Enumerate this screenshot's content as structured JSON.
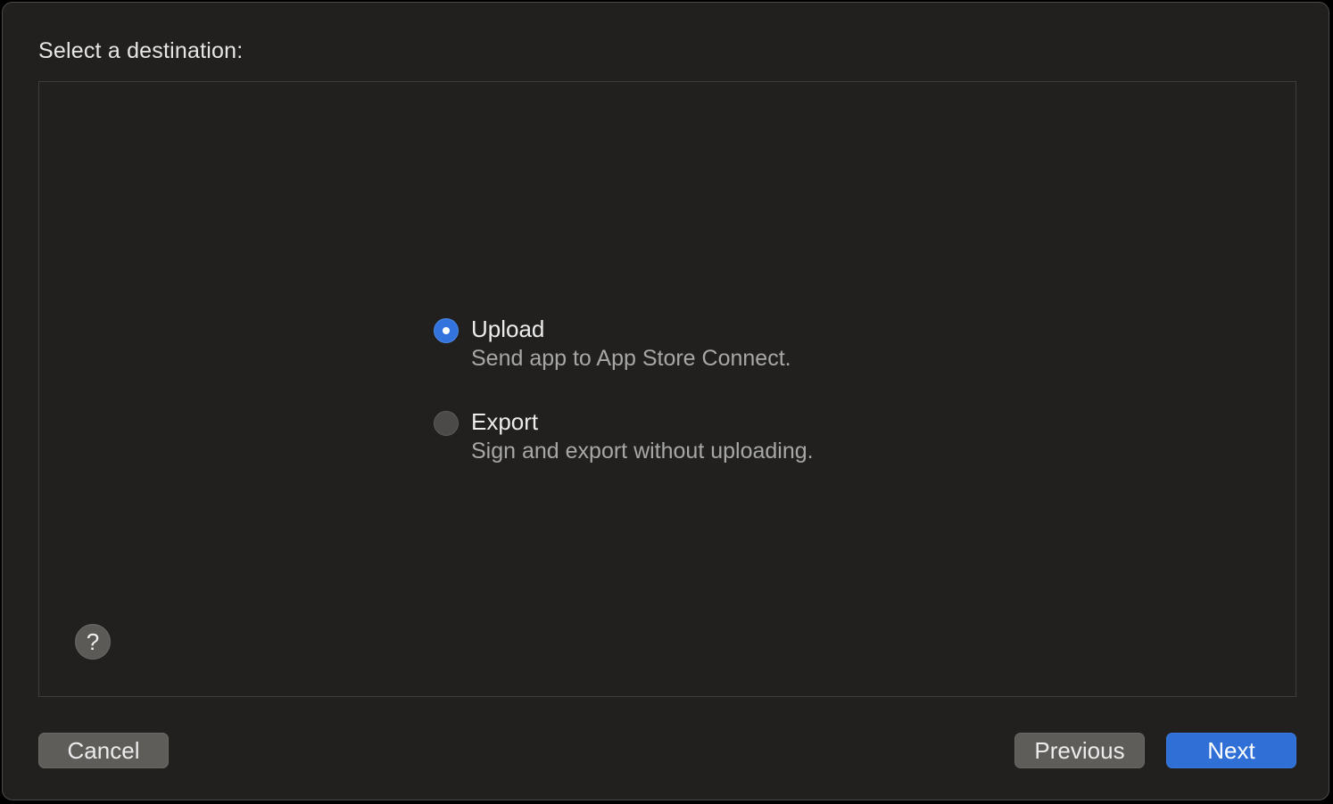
{
  "dialog": {
    "heading": "Select a destination:"
  },
  "options": [
    {
      "title": "Upload",
      "description": "Send app to App Store Connect.",
      "selected": true
    },
    {
      "title": "Export",
      "description": "Sign and export without uploading.",
      "selected": false
    }
  ],
  "help": {
    "glyph": "?",
    "icon": "help-icon"
  },
  "buttons": {
    "cancel": "Cancel",
    "previous": "Previous",
    "next": "Next"
  },
  "colors": {
    "accent": "#2f6fd6",
    "background": "#21201e",
    "button": "#5e5d5a"
  }
}
